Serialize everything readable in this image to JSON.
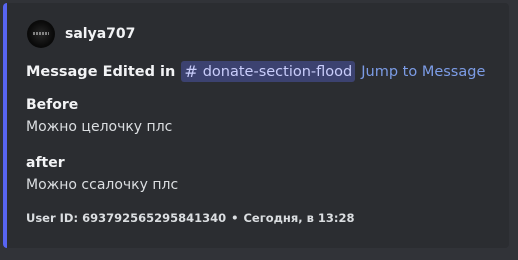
{
  "embed": {
    "accent_color": "#5865f2",
    "author": {
      "name": "salya707",
      "avatar_icon": "avatar-image"
    },
    "title": {
      "text": "Message Edited in",
      "channel_icon": "hash-icon",
      "channel_name": "donate-section-flood",
      "jump_label": "Jump to Message"
    },
    "fields": [
      {
        "name": "Before",
        "value": "Можно целочку плс"
      },
      {
        "name": "after",
        "value": "Можно ссалочку плс"
      }
    ],
    "footer": {
      "user_id": "User ID: 693792565295841340",
      "separator": "•",
      "timestamp": "Сегодня, в 13:28"
    }
  }
}
